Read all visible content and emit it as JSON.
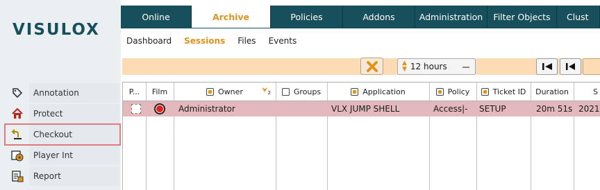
{
  "app": {
    "logo_text": "VISULOX"
  },
  "sidebar": {
    "items": [
      {
        "label": "Annotation",
        "icon": "tag-icon"
      },
      {
        "label": "Protect",
        "icon": "home-icon"
      },
      {
        "label": "Checkout",
        "icon": "return-arrow-icon",
        "selected": true
      },
      {
        "label": "Player Int",
        "icon": "film-folder-icon"
      },
      {
        "label": "Report",
        "icon": "report-icon"
      }
    ]
  },
  "tabs": [
    {
      "label": "Online"
    },
    {
      "label": "Archive",
      "active": true
    },
    {
      "label": "Policies"
    },
    {
      "label": "Addons"
    },
    {
      "label": "Administration"
    },
    {
      "label": "Filter Objects"
    },
    {
      "label": "Clust"
    }
  ],
  "subnav": [
    {
      "label": "Dashboard"
    },
    {
      "label": "Sessions",
      "active": true
    },
    {
      "label": "Files"
    },
    {
      "label": "Events"
    }
  ],
  "toolbar": {
    "time_range": "12 hours",
    "clear_icon": "close-x-icon",
    "first_icon": "skip-to-first-icon",
    "prev_icon": "previous-icon"
  },
  "table": {
    "columns": [
      {
        "label": "P..."
      },
      {
        "label": "Film"
      },
      {
        "label": "Owner",
        "check": "filled",
        "sort": "2"
      },
      {
        "label": "Groups",
        "check": "empty"
      },
      {
        "label": "Application",
        "check": "filled"
      },
      {
        "label": "Policy",
        "check": "filled"
      },
      {
        "label": "Ticket ID",
        "check": "filled"
      },
      {
        "label": "Duration"
      },
      {
        "label": "S"
      }
    ],
    "rows": [
      {
        "owner": "Administrator",
        "groups": "",
        "application": "VLX JUMP SHELL",
        "policy": "Access|-",
        "ticket_id": "SETUP",
        "duration": "20m 51s",
        "start": "2021-"
      }
    ]
  },
  "colors": {
    "brand": "#17505c",
    "accent": "#e0941e",
    "row_highlight": "#e4b9bd",
    "filter_bg": "#fddcb5",
    "selection_outline": "#e07a7e"
  }
}
